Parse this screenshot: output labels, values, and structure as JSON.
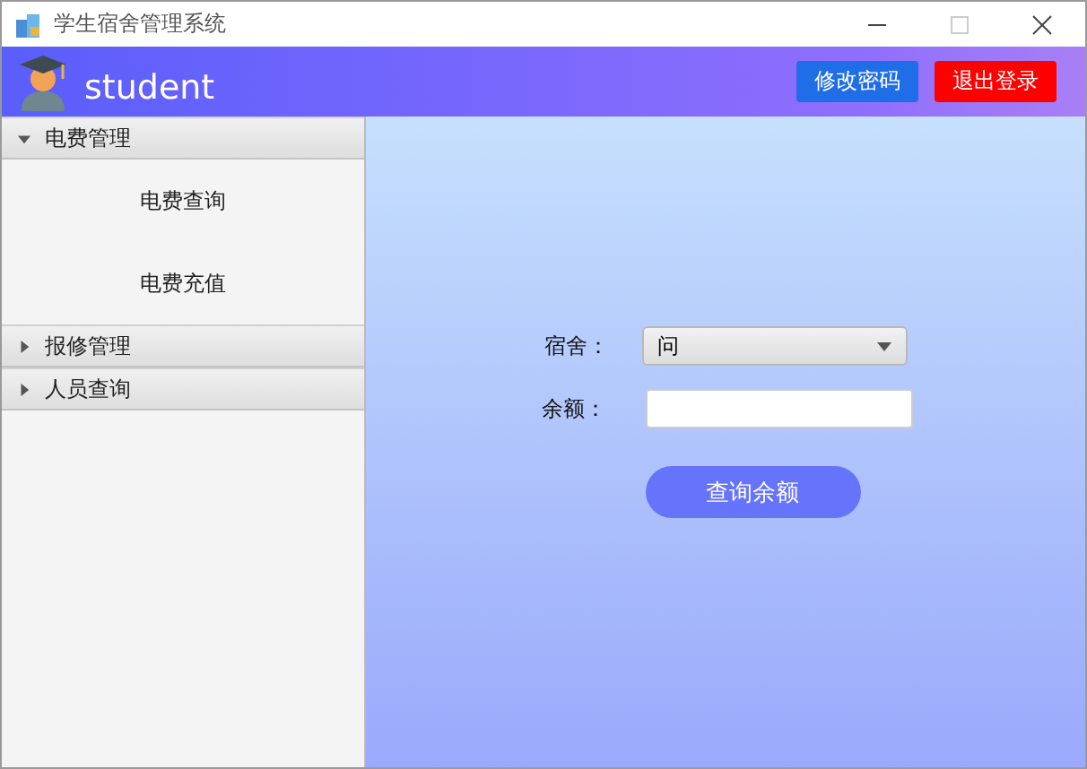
{
  "window": {
    "title": "学生宿舍管理系统"
  },
  "header": {
    "username": "student",
    "buttons": [
      {
        "label": "修改密码",
        "kind": "primary"
      },
      {
        "label": "退出登录",
        "kind": "danger"
      }
    ]
  },
  "sidebar": {
    "sections": [
      {
        "label": "电费管理",
        "expanded": true,
        "items": [
          "电费查询",
          "电费充值"
        ]
      },
      {
        "label": "报修管理",
        "expanded": false
      },
      {
        "label": "人员查询",
        "expanded": false
      }
    ]
  },
  "form": {
    "dorm_label": "宿舍：",
    "dorm_value": "问",
    "balance_label": "余额：",
    "query_button": "查询余额"
  }
}
